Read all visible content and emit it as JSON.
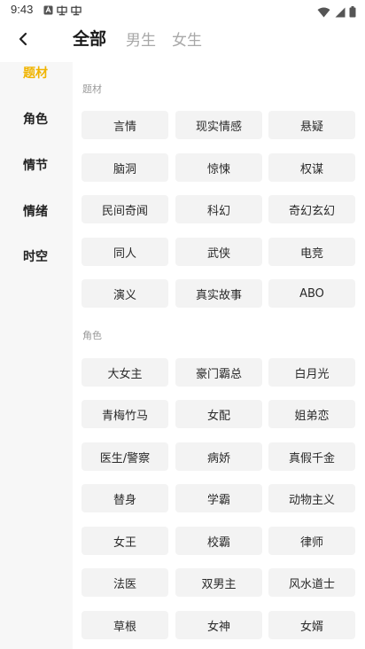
{
  "status_bar": {
    "time": "9:43"
  },
  "top_tabs": [
    {
      "label": "全部",
      "active": true
    },
    {
      "label": "男生",
      "active": false
    },
    {
      "label": "女生",
      "active": false
    }
  ],
  "sidebar": [
    {
      "label": "题材",
      "active": true
    },
    {
      "label": "角色",
      "active": false
    },
    {
      "label": "情节",
      "active": false
    },
    {
      "label": "情绪",
      "active": false
    },
    {
      "label": "时空",
      "active": false
    }
  ],
  "sections": [
    {
      "title": "题材",
      "tags": [
        "言情",
        "现实情感",
        "悬疑",
        "脑洞",
        "惊悚",
        "权谋",
        "民间奇闻",
        "科幻",
        "奇幻玄幻",
        "同人",
        "武侠",
        "电竞",
        "演义",
        "真实故事",
        "ABO"
      ]
    },
    {
      "title": "角色",
      "tags": [
        "大女主",
        "豪门霸总",
        "白月光",
        "青梅竹马",
        "女配",
        "姐弟恋",
        "医生/警察",
        "病娇",
        "真假千金",
        "替身",
        "学霸",
        "动物主义",
        "女王",
        "校霸",
        "律师",
        "法医",
        "双男主",
        "风水道士",
        "草根",
        "女神",
        "女婿"
      ]
    }
  ],
  "colors": {
    "accent": "#f0b400",
    "tag_bg": "#f3f3f3"
  },
  "icons": {
    "back": "chevron-left-icon",
    "wifi": "wifi-icon",
    "signal": "signal-icon",
    "battery": "battery-icon"
  }
}
